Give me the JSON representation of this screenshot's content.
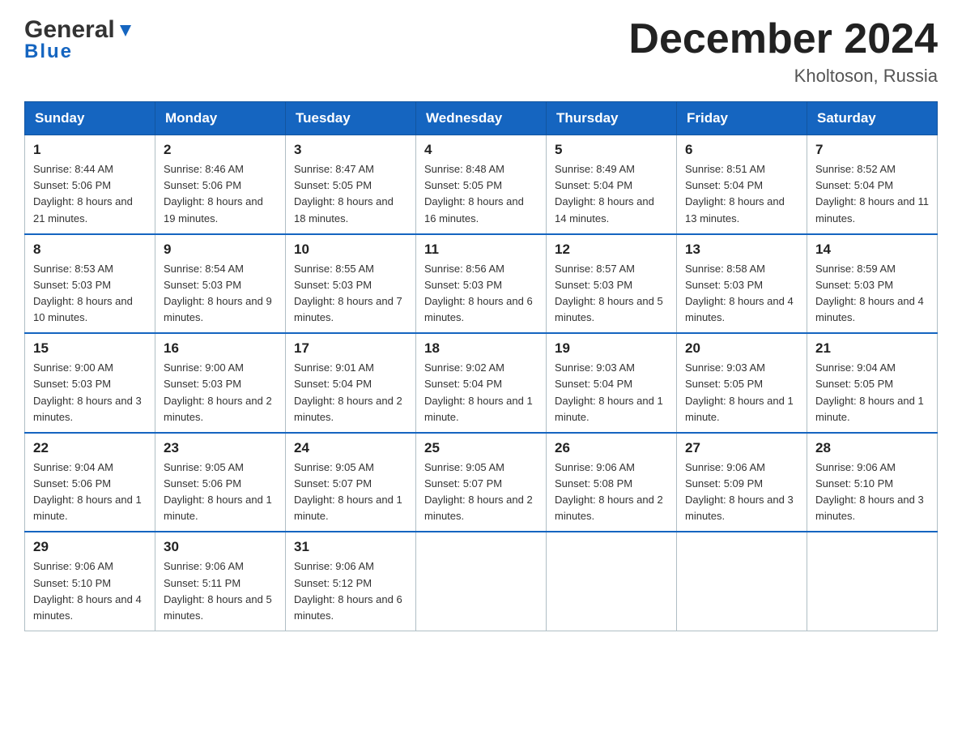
{
  "header": {
    "logo_general": "General",
    "logo_blue": "Blue",
    "title": "December 2024",
    "subtitle": "Kholtoson, Russia"
  },
  "days_of_week": [
    "Sunday",
    "Monday",
    "Tuesday",
    "Wednesday",
    "Thursday",
    "Friday",
    "Saturday"
  ],
  "weeks": [
    [
      {
        "day": "1",
        "sunrise": "8:44 AM",
        "sunset": "5:06 PM",
        "daylight": "8 hours and 21 minutes."
      },
      {
        "day": "2",
        "sunrise": "8:46 AM",
        "sunset": "5:06 PM",
        "daylight": "8 hours and 19 minutes."
      },
      {
        "day": "3",
        "sunrise": "8:47 AM",
        "sunset": "5:05 PM",
        "daylight": "8 hours and 18 minutes."
      },
      {
        "day": "4",
        "sunrise": "8:48 AM",
        "sunset": "5:05 PM",
        "daylight": "8 hours and 16 minutes."
      },
      {
        "day": "5",
        "sunrise": "8:49 AM",
        "sunset": "5:04 PM",
        "daylight": "8 hours and 14 minutes."
      },
      {
        "day": "6",
        "sunrise": "8:51 AM",
        "sunset": "5:04 PM",
        "daylight": "8 hours and 13 minutes."
      },
      {
        "day": "7",
        "sunrise": "8:52 AM",
        "sunset": "5:04 PM",
        "daylight": "8 hours and 11 minutes."
      }
    ],
    [
      {
        "day": "8",
        "sunrise": "8:53 AM",
        "sunset": "5:03 PM",
        "daylight": "8 hours and 10 minutes."
      },
      {
        "day": "9",
        "sunrise": "8:54 AM",
        "sunset": "5:03 PM",
        "daylight": "8 hours and 9 minutes."
      },
      {
        "day": "10",
        "sunrise": "8:55 AM",
        "sunset": "5:03 PM",
        "daylight": "8 hours and 7 minutes."
      },
      {
        "day": "11",
        "sunrise": "8:56 AM",
        "sunset": "5:03 PM",
        "daylight": "8 hours and 6 minutes."
      },
      {
        "day": "12",
        "sunrise": "8:57 AM",
        "sunset": "5:03 PM",
        "daylight": "8 hours and 5 minutes."
      },
      {
        "day": "13",
        "sunrise": "8:58 AM",
        "sunset": "5:03 PM",
        "daylight": "8 hours and 4 minutes."
      },
      {
        "day": "14",
        "sunrise": "8:59 AM",
        "sunset": "5:03 PM",
        "daylight": "8 hours and 4 minutes."
      }
    ],
    [
      {
        "day": "15",
        "sunrise": "9:00 AM",
        "sunset": "5:03 PM",
        "daylight": "8 hours and 3 minutes."
      },
      {
        "day": "16",
        "sunrise": "9:00 AM",
        "sunset": "5:03 PM",
        "daylight": "8 hours and 2 minutes."
      },
      {
        "day": "17",
        "sunrise": "9:01 AM",
        "sunset": "5:04 PM",
        "daylight": "8 hours and 2 minutes."
      },
      {
        "day": "18",
        "sunrise": "9:02 AM",
        "sunset": "5:04 PM",
        "daylight": "8 hours and 1 minute."
      },
      {
        "day": "19",
        "sunrise": "9:03 AM",
        "sunset": "5:04 PM",
        "daylight": "8 hours and 1 minute."
      },
      {
        "day": "20",
        "sunrise": "9:03 AM",
        "sunset": "5:05 PM",
        "daylight": "8 hours and 1 minute."
      },
      {
        "day": "21",
        "sunrise": "9:04 AM",
        "sunset": "5:05 PM",
        "daylight": "8 hours and 1 minute."
      }
    ],
    [
      {
        "day": "22",
        "sunrise": "9:04 AM",
        "sunset": "5:06 PM",
        "daylight": "8 hours and 1 minute."
      },
      {
        "day": "23",
        "sunrise": "9:05 AM",
        "sunset": "5:06 PM",
        "daylight": "8 hours and 1 minute."
      },
      {
        "day": "24",
        "sunrise": "9:05 AM",
        "sunset": "5:07 PM",
        "daylight": "8 hours and 1 minute."
      },
      {
        "day": "25",
        "sunrise": "9:05 AM",
        "sunset": "5:07 PM",
        "daylight": "8 hours and 2 minutes."
      },
      {
        "day": "26",
        "sunrise": "9:06 AM",
        "sunset": "5:08 PM",
        "daylight": "8 hours and 2 minutes."
      },
      {
        "day": "27",
        "sunrise": "9:06 AM",
        "sunset": "5:09 PM",
        "daylight": "8 hours and 3 minutes."
      },
      {
        "day": "28",
        "sunrise": "9:06 AM",
        "sunset": "5:10 PM",
        "daylight": "8 hours and 3 minutes."
      }
    ],
    [
      {
        "day": "29",
        "sunrise": "9:06 AM",
        "sunset": "5:10 PM",
        "daylight": "8 hours and 4 minutes."
      },
      {
        "day": "30",
        "sunrise": "9:06 AM",
        "sunset": "5:11 PM",
        "daylight": "8 hours and 5 minutes."
      },
      {
        "day": "31",
        "sunrise": "9:06 AM",
        "sunset": "5:12 PM",
        "daylight": "8 hours and 6 minutes."
      },
      null,
      null,
      null,
      null
    ]
  ],
  "labels": {
    "sunrise": "Sunrise:",
    "sunset": "Sunset:",
    "daylight": "Daylight:"
  }
}
